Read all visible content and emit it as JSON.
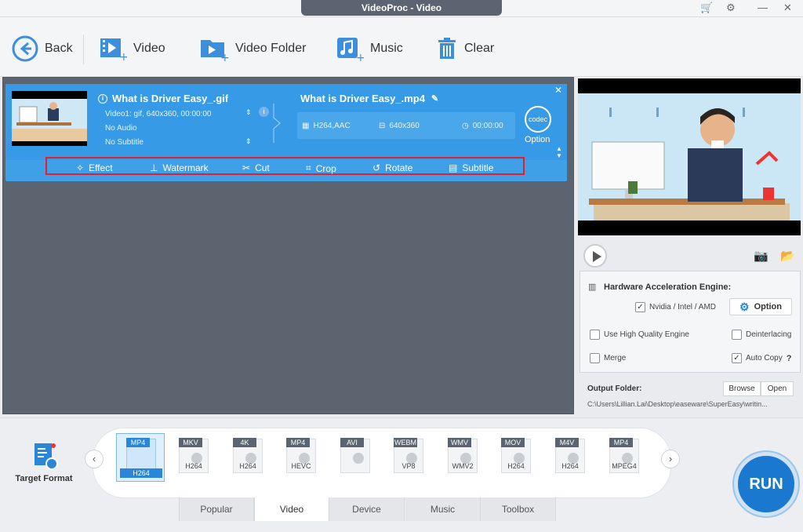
{
  "window": {
    "title": "VideoProc - Video"
  },
  "toolbar": {
    "back": "Back",
    "video": "Video",
    "video_folder": "Video Folder",
    "music": "Music",
    "clear": "Clear"
  },
  "card": {
    "source_title": "What is Driver Easy_.gif",
    "source_video": "Video1: gif, 640x360, 00:00:00",
    "source_audio": "No Audio",
    "source_subtitle": "No Subtitle",
    "output_title": "What is Driver Easy_.mp4",
    "output_codec": "H264,AAC",
    "output_resolution": "640x360",
    "output_duration": "00:00:00",
    "codec_icon_text": "codec",
    "option_label": "Option",
    "actions": [
      "Effect",
      "Watermark",
      "Cut",
      "Crop",
      "Rotate",
      "Subtitle"
    ]
  },
  "settings": {
    "hw_title": "Hardware Acceleration Engine:",
    "nvidia_intel_amd": "Nvidia / Intel / AMD",
    "option_button": "Option",
    "high_quality": "Use High Quality Engine",
    "deinterlacing": "Deinterlacing",
    "merge": "Merge",
    "auto_copy": "Auto Copy",
    "auto_copy_help": "?",
    "checked": {
      "nvidia_intel_amd": true,
      "high_quality": false,
      "deinterlacing": false,
      "merge": false,
      "auto_copy": true
    }
  },
  "output_folder": {
    "label": "Output Folder:",
    "browse": "Browse",
    "open": "Open",
    "path": "C:\\Users\\Lillian.Lai\\Desktop\\easeware\\SuperEasy\\writin..."
  },
  "target_format": {
    "label": "Target Format"
  },
  "formats": [
    {
      "tag": "MP4",
      "codec": "H264",
      "selected": true
    },
    {
      "tag": "MKV",
      "codec": "H264"
    },
    {
      "tag": "4K",
      "codec": "H264"
    },
    {
      "tag": "MP4",
      "codec": "HEVC"
    },
    {
      "tag": "AVI",
      "codec": ""
    },
    {
      "tag": "WEBM",
      "codec": "VP8"
    },
    {
      "tag": "WMV",
      "codec": "WMV2"
    },
    {
      "tag": "MOV",
      "codec": "H264"
    },
    {
      "tag": "M4V",
      "codec": "H264"
    },
    {
      "tag": "MP4",
      "codec": "MPEG4"
    }
  ],
  "tabs": [
    "Popular",
    "Video",
    "Device",
    "Music",
    "Toolbox"
  ],
  "active_tab": "Video",
  "run_label": "RUN",
  "colors": {
    "accent": "#379ae6",
    "highlight_border": "#e0202a",
    "run": "#1a78cf"
  }
}
